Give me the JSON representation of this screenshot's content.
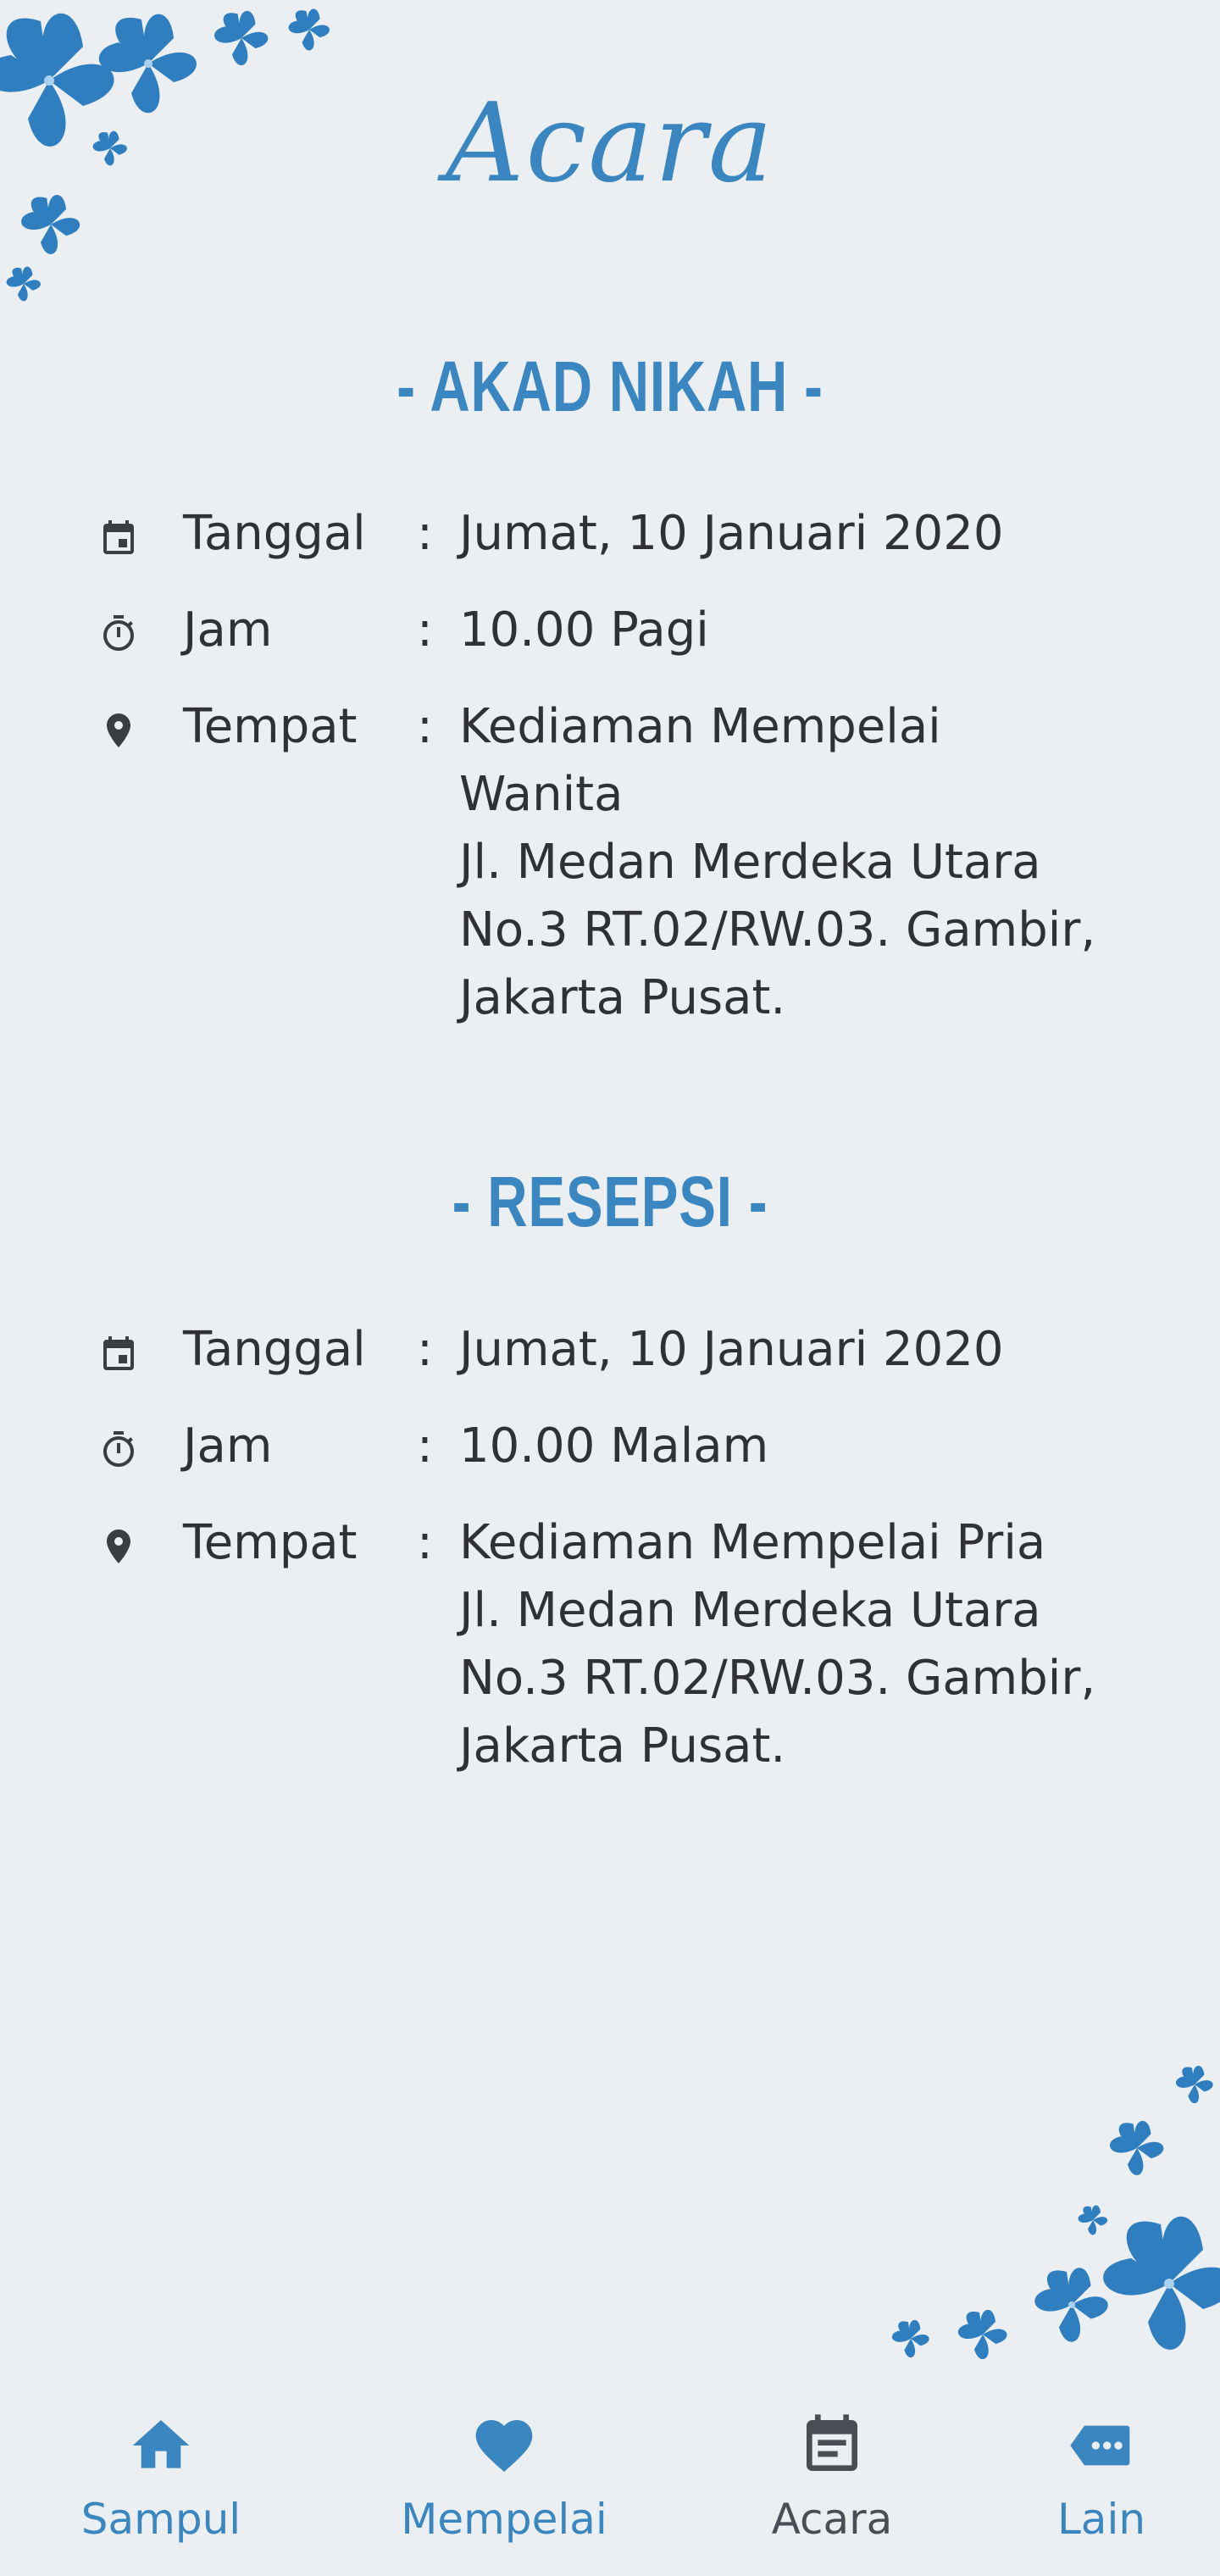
{
  "page": {
    "title": "Acara"
  },
  "colors": {
    "accent": "#3a86c0",
    "text": "#2f3134",
    "background": "#eceff2",
    "icon": "#3a3d42"
  },
  "akad": {
    "title": "- AKAD NIKAH -",
    "rows": [
      {
        "icon": "calendar-icon",
        "label": "Tanggal",
        "colon": ":",
        "lines": [
          "Jumat, 10 Januari 2020"
        ]
      },
      {
        "icon": "timer-icon",
        "label": "Jam",
        "colon": ":",
        "lines": [
          "10.00 Pagi"
        ]
      },
      {
        "icon": "location-pin-icon",
        "label": "Tempat",
        "colon": ":",
        "lines": [
          "Kediaman Mempelai",
          "Wanita",
          "Jl. Medan Merdeka Utara",
          "No.3 RT.02/RW.03. Gambir,",
          "Jakarta Pusat."
        ]
      }
    ]
  },
  "resepsi": {
    "title": "- RESEPSI -",
    "rows": [
      {
        "icon": "calendar-icon",
        "label": "Tanggal",
        "colon": ":",
        "lines": [
          "Jumat, 10 Januari 2020"
        ]
      },
      {
        "icon": "timer-icon",
        "label": "Jam",
        "colon": ":",
        "lines": [
          "10.00 Malam"
        ]
      },
      {
        "icon": "location-pin-icon",
        "label": "Tempat",
        "colon": ":",
        "lines": [
          "Kediaman Mempelai Pria",
          "Jl. Medan Merdeka Utara",
          "No.3 RT.02/RW.03. Gambir,",
          "Jakarta Pusat."
        ]
      }
    ]
  },
  "nav": {
    "items": [
      {
        "icon": "home-icon",
        "label": "Sampul",
        "active": false
      },
      {
        "icon": "heart-icon",
        "label": "Mempelai",
        "active": false
      },
      {
        "icon": "event-note-icon",
        "label": "Acara",
        "active": true
      },
      {
        "icon": "chat-bubble-icon",
        "label": "Lain",
        "active": false
      }
    ]
  }
}
